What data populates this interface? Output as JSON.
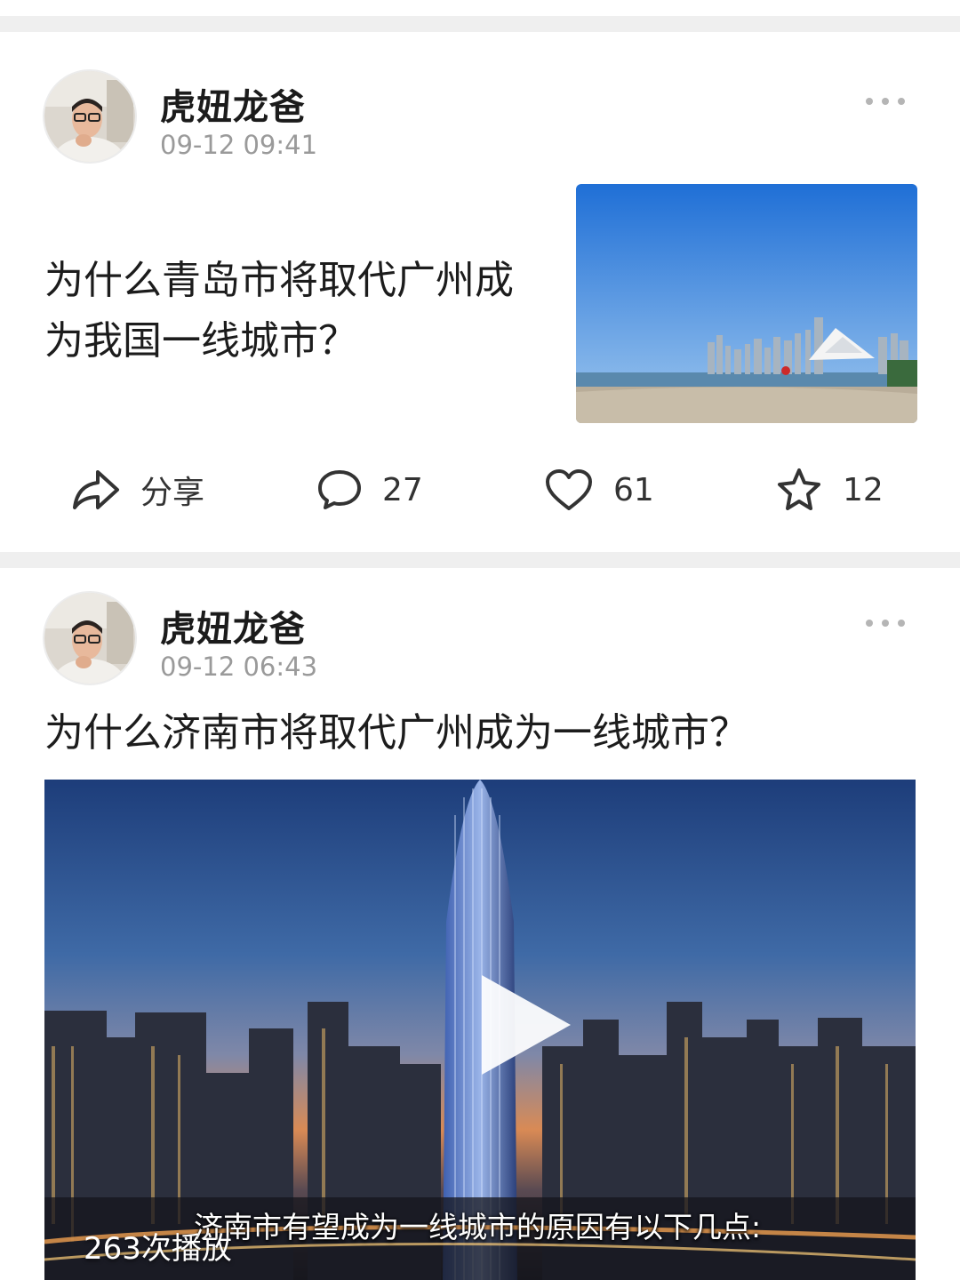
{
  "posts": [
    {
      "author": "虎妞龙爸",
      "time": "09-12 09:41",
      "title": "为什么青岛市将取代广州成为我国一线城市？",
      "actions": {
        "share": "分享",
        "comments": "27",
        "likes": "61",
        "favorites": "12"
      }
    },
    {
      "author": "虎妞龙爸",
      "time": "09-12 06:43",
      "title": "为什么济南市将取代广州成为一线城市？",
      "video": {
        "play_count": "263次播放",
        "subtitle": "济南市有望成为一线城市的原因有以下几点:"
      }
    }
  ],
  "icons": {
    "more": "more-dots-icon",
    "share": "share-arrow-icon",
    "comment": "comment-bubble-icon",
    "like": "heart-icon",
    "favorite": "star-icon",
    "play": "play-icon"
  }
}
